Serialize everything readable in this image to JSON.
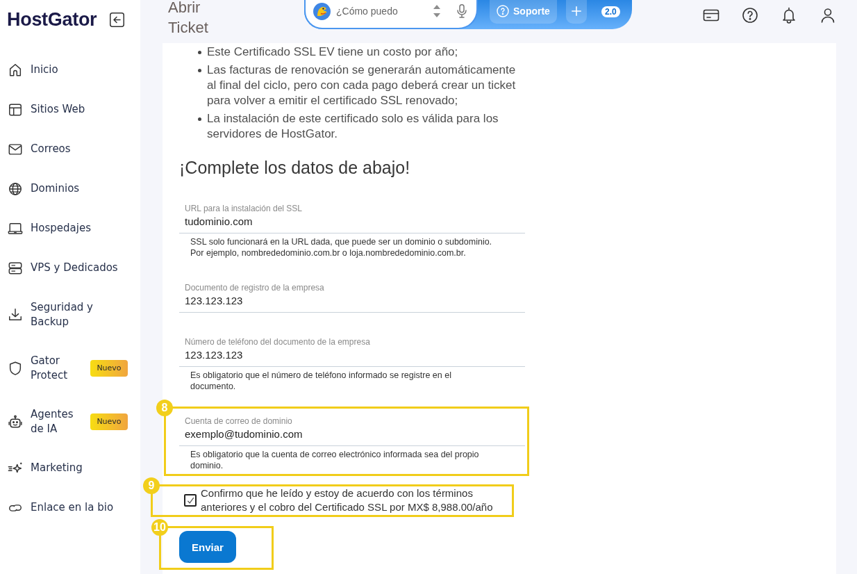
{
  "sidebar": {
    "logo": "HostGator",
    "items": [
      {
        "label": "Inicio",
        "selected": false
      },
      {
        "label": "Sitios Web",
        "selected": false
      },
      {
        "label": "Correos",
        "selected": false
      },
      {
        "label": "Dominios",
        "selected": false
      },
      {
        "label": "Hospedajes",
        "selected": false
      },
      {
        "label": "VPS y Dedicados",
        "selected": false
      },
      {
        "label": "Seguridad y Backup",
        "selected": false
      },
      {
        "label": "Gator Protect",
        "badge": "Nuevo",
        "selected": false
      },
      {
        "label": "Agentes de IA",
        "badge": "Nuevo",
        "selected": false
      },
      {
        "label": "Marketing",
        "selected": false
      },
      {
        "label": "Enlace en la bio",
        "selected": false
      }
    ]
  },
  "header": {
    "title": "Abrir Ticket",
    "search": {
      "placeholder": "¿Cómo puedo"
    },
    "support_button": "Soporte",
    "version_badge": "2.0"
  },
  "content": {
    "bullets": [
      "Este Certificado SSL EV tiene un costo por año;",
      "Las facturas de renovación se generarán automáticamente al final del ciclo, pero con cada pago deberá crear un ticket para volver a emitir el certificado SSL renovado;",
      "La instalación de este certificado solo es válida para los servidores de HostGator."
    ],
    "heading": "¡Complete los datos de abajo!",
    "fields": [
      {
        "label": "URL para la instalación del SSL",
        "value": "tudominio.com",
        "helper": "SSL solo funcionará en la URL dada, que puede ser un dominio o subdominio. Por ejemplo, nombrededominio.com.br o loja.nombrededominio.com.br."
      },
      {
        "label": "Documento de registro de la empresa",
        "value": "123.123.123"
      },
      {
        "label": "Número de teléfono del documento de la empresa",
        "value": "123.123.123",
        "helper": "Es obligatorio que el número de teléfono informado se registre en el documento."
      },
      {
        "label": "Cuenta de correo de dominio",
        "value": "exemplo@tudominio.com",
        "helper": "Es obligatorio que la cuenta de correo electrónico informada sea del propio dominio.",
        "callout": "8"
      }
    ],
    "agreement": {
      "text": "Confirmo que he leído y estoy de acuerdo con los términos anteriores y el cobro del Certificado SSL por MX$ 8,988.00/año",
      "checked": true,
      "callout": "9"
    },
    "submit": {
      "label": "Enviar",
      "callout": "10"
    }
  }
}
